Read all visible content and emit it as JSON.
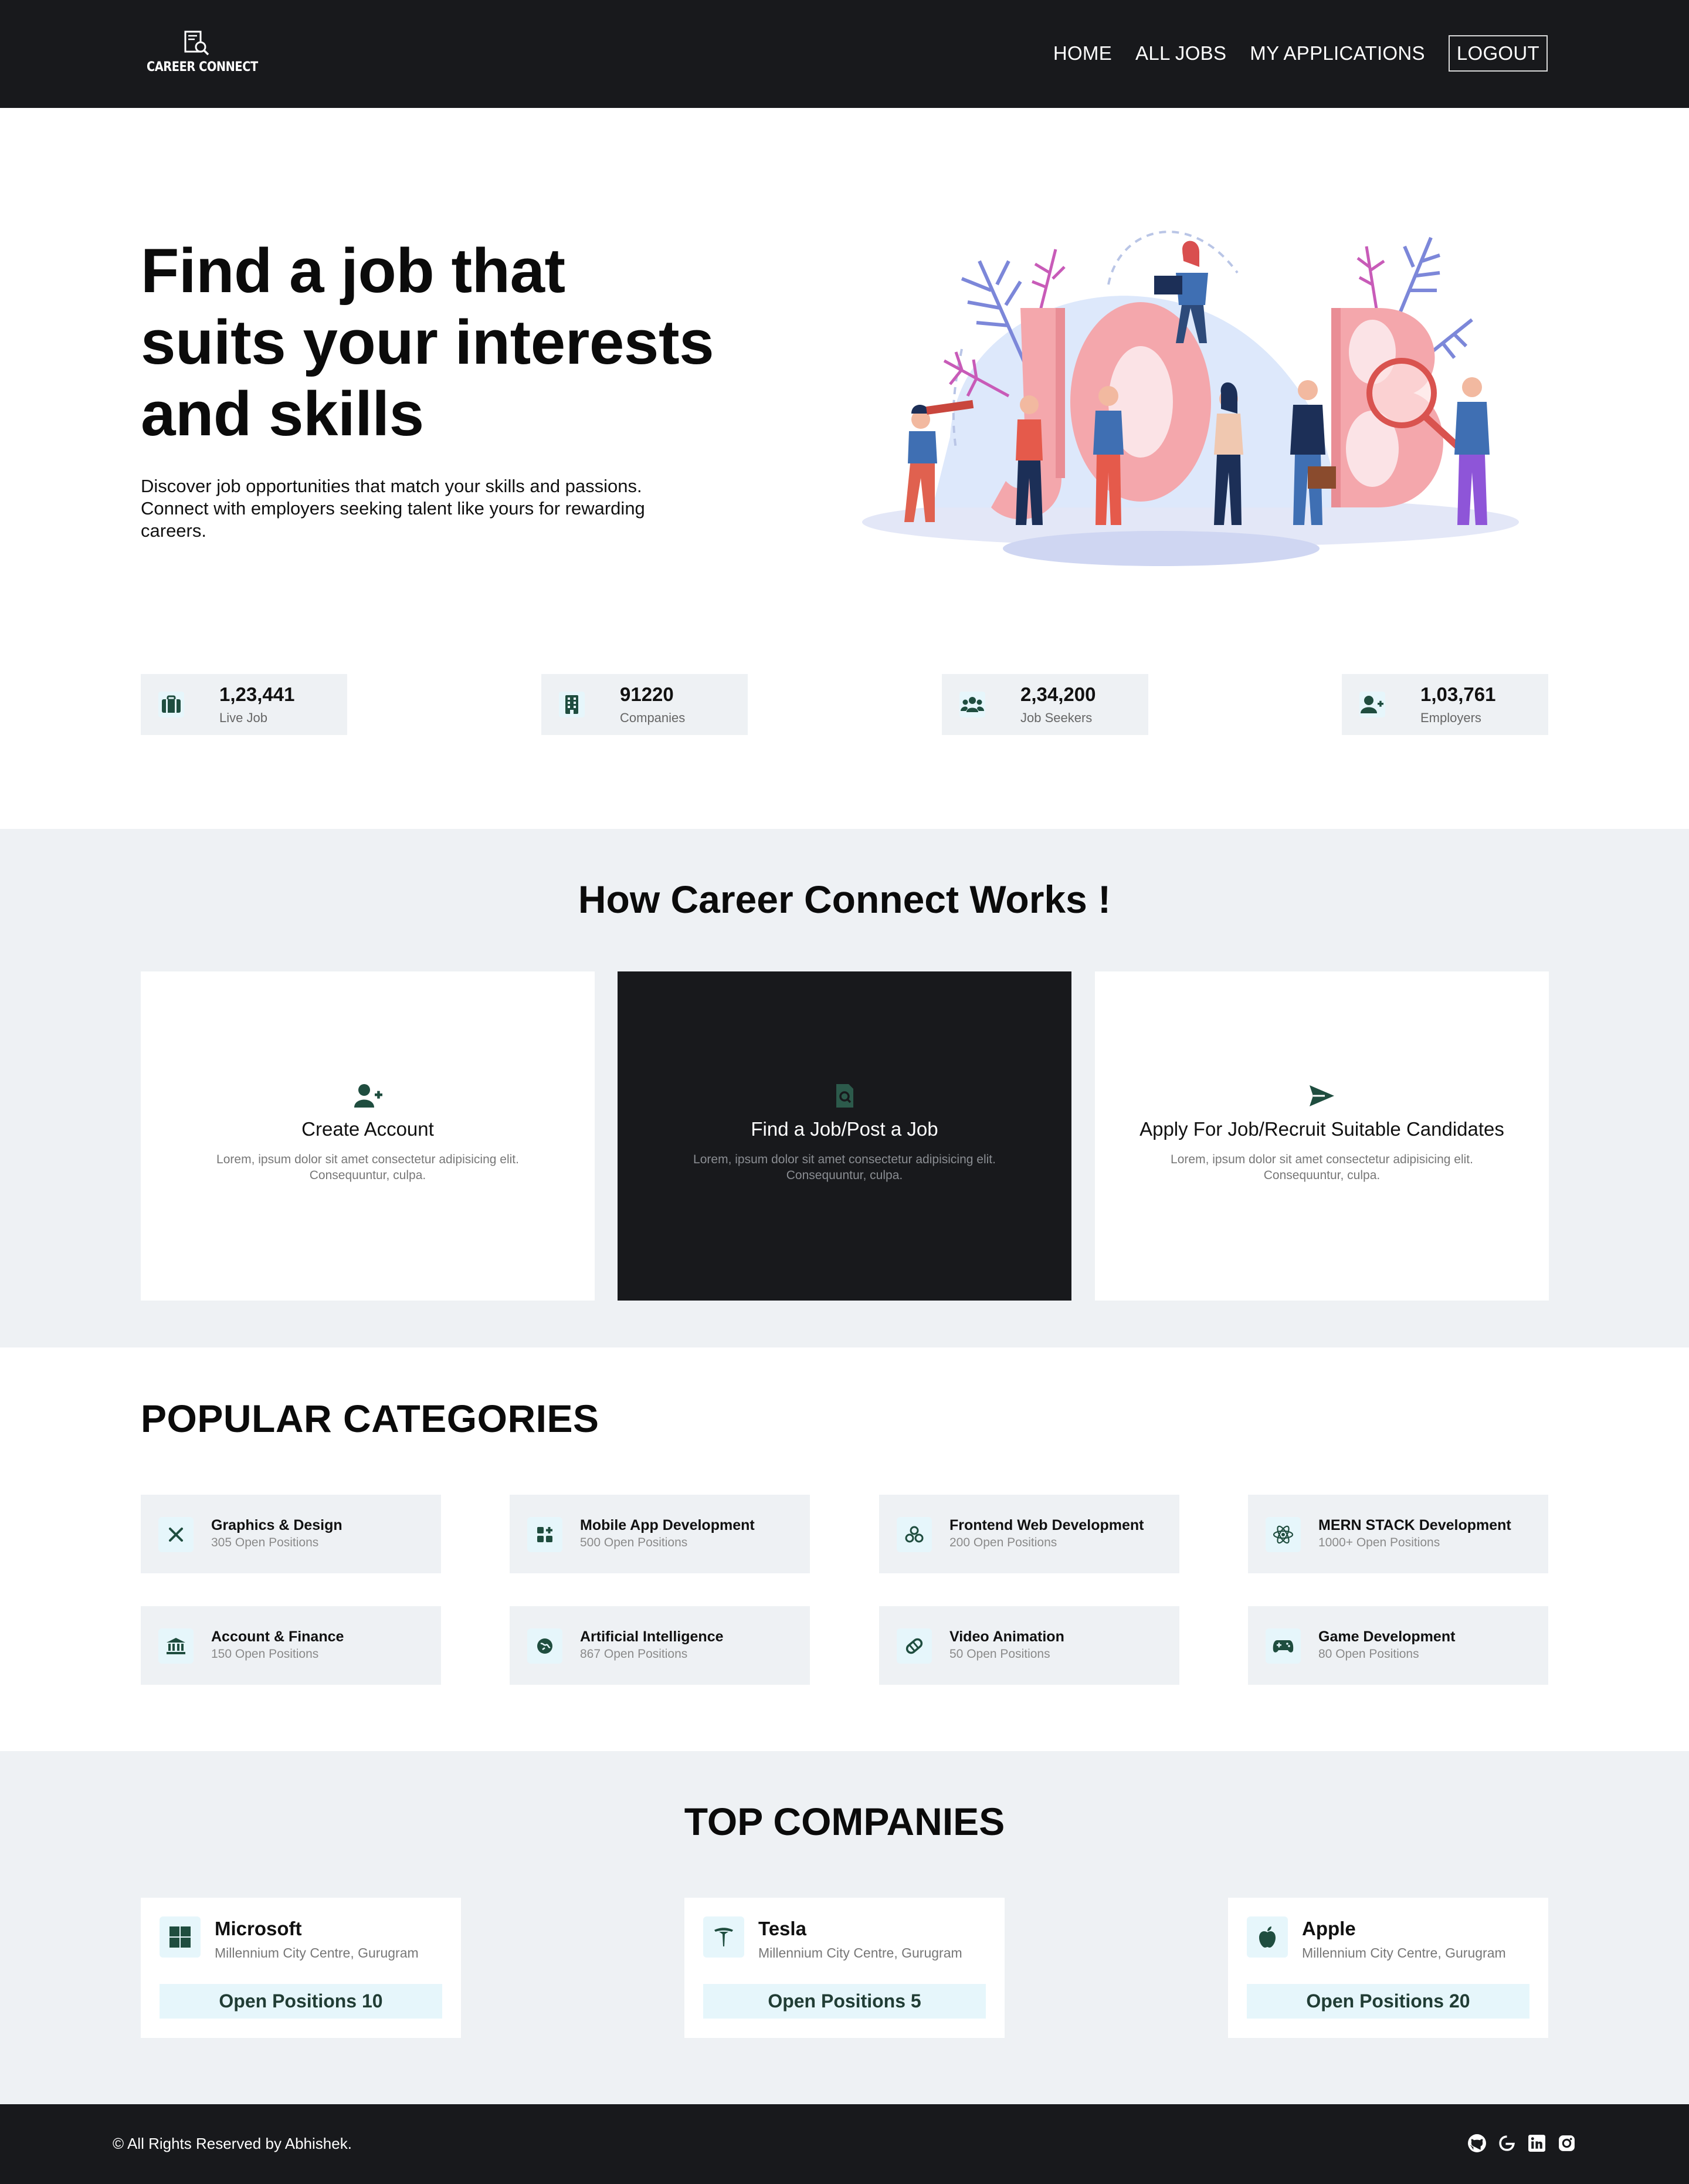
{
  "brand": {
    "name": "CAREER CONNECT",
    "logo_icon": "resume-magnifier-icon"
  },
  "nav": {
    "home": "HOME",
    "all_jobs": "ALL JOBS",
    "my_applications": "MY APPLICATIONS",
    "logout": "LOGOUT"
  },
  "hero": {
    "title": "Find a job that suits your interests and skills",
    "description": "Discover job opportunities that match your skills and passions. Connect with employers seeking talent like yours for rewarding careers.",
    "illustration_text": "JOB"
  },
  "stats": [
    {
      "value": "1,23,441",
      "label": "Live Job",
      "icon": "briefcase-icon"
    },
    {
      "value": "91220",
      "label": "Companies",
      "icon": "building-icon"
    },
    {
      "value": "2,34,200",
      "label": "Job Seekers",
      "icon": "users-icon"
    },
    {
      "value": "1,03,761",
      "label": "Employers",
      "icon": "user-plus-icon"
    }
  ],
  "how": {
    "title": "How Career Connect Works !",
    "cards": [
      {
        "title": "Create Account",
        "text": "Lorem, ipsum dolor sit amet consectetur adipisicing elit. Consequuntur, culpa.",
        "icon": "user-plus-icon"
      },
      {
        "title": "Find a Job/Post a Job",
        "text": "Lorem, ipsum dolor sit amet consectetur adipisicing elit. Consequuntur, culpa.",
        "icon": "file-search-icon"
      },
      {
        "title": "Apply For Job/Recruit Suitable Candidates",
        "text": "Lorem, ipsum dolor sit amet consectetur adipisicing elit. Consequuntur, culpa.",
        "icon": "send-icon"
      }
    ]
  },
  "categories": {
    "title": "POPULAR CATEGORIES",
    "items": [
      {
        "name": "Graphics & Design",
        "count": "305 Open Positions",
        "icon": "design-tools-icon"
      },
      {
        "name": "Mobile App Development",
        "count": "500 Open Positions",
        "icon": "app-grid-icon"
      },
      {
        "name": "Frontend Web Development",
        "count": "200 Open Positions",
        "icon": "web-link-icon"
      },
      {
        "name": "MERN STACK Development",
        "count": "1000+ Open Positions",
        "icon": "react-atom-icon"
      },
      {
        "name": "Account & Finance",
        "count": "150 Open Positions",
        "icon": "bank-icon"
      },
      {
        "name": "Artificial Intelligence",
        "count": "867 Open Positions",
        "icon": "brain-icon"
      },
      {
        "name": "Video Animation",
        "count": "50 Open Positions",
        "icon": "film-reel-icon"
      },
      {
        "name": "Game Development",
        "count": "80 Open Positions",
        "icon": "gamepad-icon"
      }
    ]
  },
  "companies": {
    "title": "TOP COMPANIES",
    "items": [
      {
        "name": "Microsoft",
        "location": "Millennium City Centre, Gurugram",
        "button": "Open Positions 10",
        "icon": "microsoft-logo-icon"
      },
      {
        "name": "Tesla",
        "location": "Millennium City Centre, Gurugram",
        "button": "Open Positions 5",
        "icon": "tesla-logo-icon"
      },
      {
        "name": "Apple",
        "location": "Millennium City Centre, Gurugram",
        "button": "Open Positions 20",
        "icon": "apple-logo-icon"
      }
    ]
  },
  "footer": {
    "copyright": "© All Rights Reserved by Abhishek.",
    "icons": [
      "github-icon",
      "geeksforgeeks-icon",
      "linkedin-icon",
      "instagram-icon"
    ]
  },
  "colors": {
    "dark": "#18191c",
    "light_bg": "#eef1f4",
    "accent_bg": "#e6f6fb",
    "icon_green": "#1f4d3f"
  }
}
